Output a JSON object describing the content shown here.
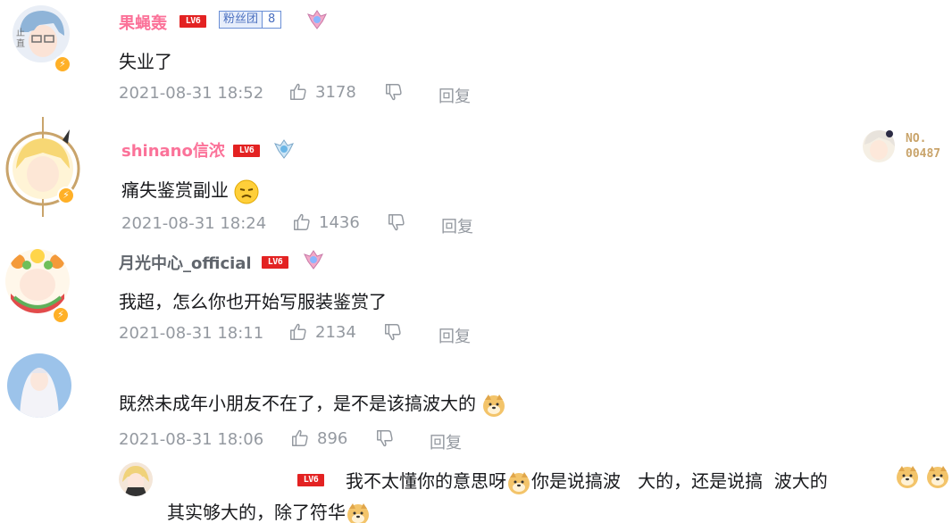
{
  "comments": [
    {
      "username": "果蝇轰",
      "level": "LV6",
      "fans_label": "粉丝团",
      "fans_level": "8",
      "content": "失业了",
      "time": "2021-08-31 18:52",
      "likes": "3178",
      "reply_label": "回复"
    },
    {
      "username": "shinano信浓",
      "level": "LV6",
      "content": "痛失鉴赏副业",
      "time": "2021-08-31 18:24",
      "likes": "1436",
      "reply_label": "回复",
      "card_badge_no": "NO.",
      "card_badge_num": "00487"
    },
    {
      "username": "月光中心_official",
      "level": "LV6",
      "content": "我超，怎么你也开始写服装鉴赏了",
      "time": "2021-08-31 18:11",
      "likes": "2134",
      "reply_label": "回复"
    },
    {
      "content": "既然未成年小朋友不在了，是不是该搞波大的",
      "time": "2021-08-31 18:06",
      "likes": "896",
      "reply_label": "回复"
    }
  ],
  "sub_reply": {
    "level": "LV6",
    "content_a": "我不太懂你的意思呀",
    "content_b": "你是说搞波   大的，还是说搞  波大的",
    "content_c": "其实够大的，除了符华"
  },
  "colors": {
    "vip_pink": "#fb7299",
    "meta_gray": "#9499a0",
    "level_red": "#e32222"
  }
}
